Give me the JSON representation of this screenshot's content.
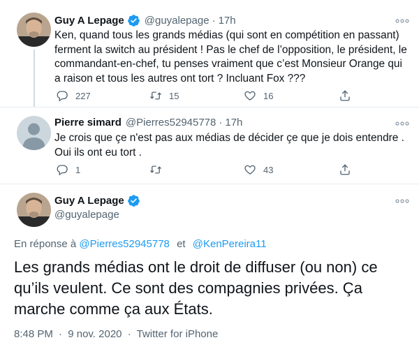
{
  "tweets": [
    {
      "display_name": "Guy A Lepage",
      "handle": "@guyalepage",
      "time": "17h",
      "verified": true,
      "text": "Ken, quand tous les grands médias (qui sont en compétition en passant) ferment la switch au président ! Pas le chef de l’opposition, le président, le commandant-en-chef, tu penses vraiment que c’est Monsieur Orange qui a raison et tous les autres ont tort ? Incluant Fox ???",
      "replies": "227",
      "retweets": "15",
      "likes": "16"
    },
    {
      "display_name": "Pierre simard",
      "handle": "@Pierres52945778",
      "time": "17h",
      "verified": false,
      "text": "Je crois que çe n'est pas aux médias de décider çe que je dois entendre . Oui ils ont eu tort .",
      "replies": "1",
      "retweets": "",
      "likes": "43"
    }
  ],
  "main_tweet": {
    "display_name": "Guy A Lepage",
    "handle": "@guyalepage",
    "verified": true,
    "reply_prefix": "En réponse à",
    "reply_mention_1": "@Pierres52945778",
    "reply_connector": "et",
    "reply_mention_2": "@KenPereira11",
    "text": "Les grands médias ont le droit de diffuser (ou non) ce qu’ils veulent. Ce sont des compagnies privées. Ça marche comme ça aux États.",
    "time": "8:48 PM",
    "date": "9 nov. 2020",
    "source": "Twitter for iPhone",
    "separator": "·"
  },
  "icons": {
    "more": "more-horizontal-icon",
    "reply": "reply-icon",
    "retweet": "retweet-icon",
    "like": "heart-icon",
    "share": "share-icon",
    "verified": "verified-badge-icon"
  },
  "colors": {
    "accent": "#1d9bf0",
    "text": "#0f1419",
    "secondary": "#536471",
    "divider": "#e6ecf0"
  }
}
